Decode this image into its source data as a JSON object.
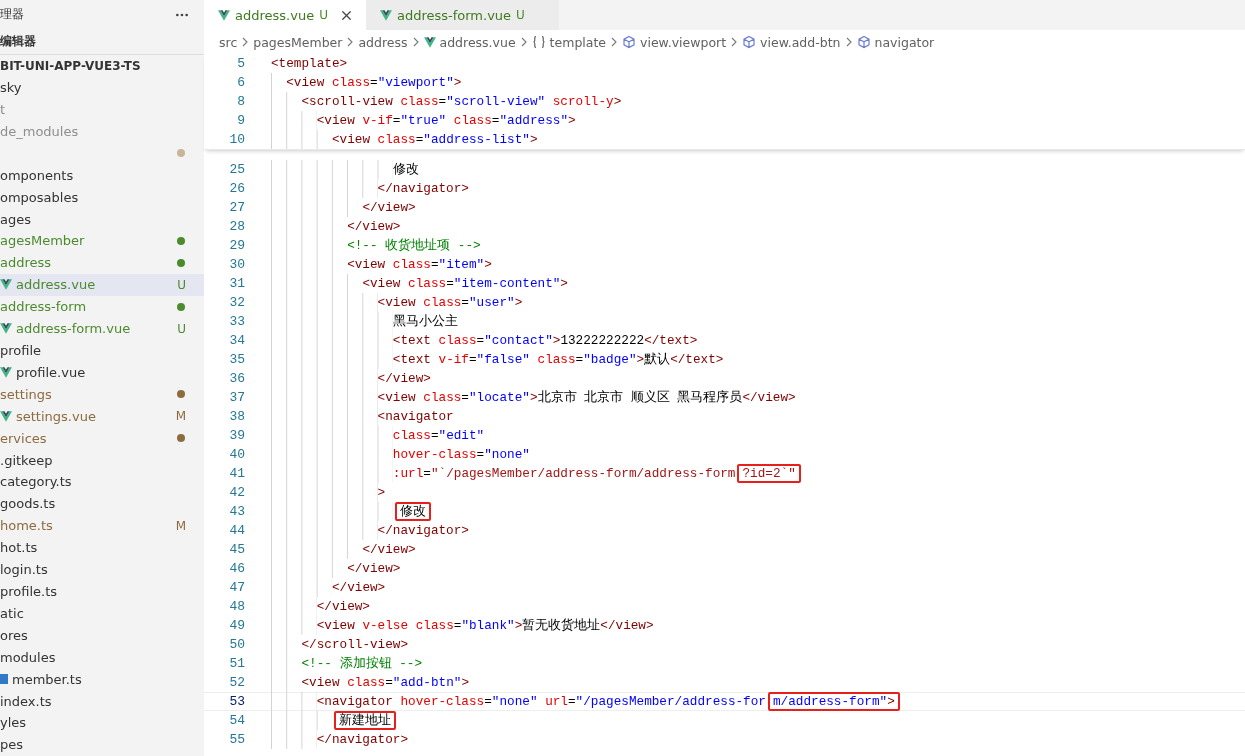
{
  "sidebar": {
    "title": "理器",
    "section": "编辑器",
    "project": "BIT-UNI-APP-VUE3-TS",
    "items": [
      {
        "label": "sky",
        "kind": "plain",
        "color": "#333333",
        "selected": false
      },
      {
        "label": "t",
        "kind": "plain",
        "color": "#8e8e8e",
        "selected": false
      },
      {
        "label": "de_modules",
        "kind": "plain",
        "color": "#8e8e8e",
        "selected": false
      },
      {
        "kind": "plain",
        "color": "#c9b597",
        "dot": true,
        "selected": false
      },
      {
        "label": "omponents",
        "kind": "plain",
        "color": "#333333",
        "selected": false
      },
      {
        "label": "omposables",
        "kind": "plain",
        "color": "#333333",
        "selected": false
      },
      {
        "label": "ages",
        "kind": "plain",
        "color": "#333333",
        "selected": false
      },
      {
        "label": "agesMember",
        "kind": "plain",
        "color": "#4c8a2e",
        "dot": true,
        "selected": false
      },
      {
        "label": "address",
        "kind": "plain",
        "color": "#4c8a2e",
        "dot": true,
        "selected": false
      },
      {
        "label": "address.vue",
        "kind": "vue",
        "color": "#4c8a2e",
        "badge": "U",
        "selected": true
      },
      {
        "label": "address-form",
        "kind": "plain",
        "color": "#4c8a2e",
        "dot": true,
        "selected": false
      },
      {
        "label": "address-form.vue",
        "kind": "vue",
        "color": "#4c8a2e",
        "badge": "U",
        "selected": false
      },
      {
        "label": "profile",
        "kind": "plain",
        "color": "#333333",
        "selected": false
      },
      {
        "label": "profile.vue",
        "kind": "vue",
        "color": "#333333",
        "selected": false
      },
      {
        "label": "settings",
        "kind": "plain",
        "color": "#8c6c3e",
        "dot": true,
        "selected": false
      },
      {
        "label": "settings.vue",
        "kind": "vue",
        "color": "#8c6c3e",
        "badge": "M",
        "selected": false
      },
      {
        "label": "ervices",
        "kind": "plain",
        "color": "#8c6c3e",
        "dot": true,
        "selected": false
      },
      {
        "label": ".gitkeep",
        "kind": "plain",
        "color": "#333333",
        "selected": false
      },
      {
        "label": "category.ts",
        "kind": "plain",
        "color": "#333333",
        "selected": false
      },
      {
        "label": "goods.ts",
        "kind": "plain",
        "color": "#333333",
        "selected": false
      },
      {
        "label": "home.ts",
        "kind": "plain",
        "color": "#8c6c3e",
        "badge": "M",
        "selected": false
      },
      {
        "label": "hot.ts",
        "kind": "plain",
        "color": "#333333",
        "selected": false
      },
      {
        "label": "login.ts",
        "kind": "plain",
        "color": "#333333",
        "selected": false
      },
      {
        "label": "profile.ts",
        "kind": "plain",
        "color": "#333333",
        "selected": false
      },
      {
        "label": "atic",
        "kind": "plain",
        "color": "#333333",
        "selected": false
      },
      {
        "label": "ores",
        "kind": "plain",
        "color": "#333333",
        "selected": false
      },
      {
        "label": "modules",
        "kind": "plain",
        "color": "#333333",
        "selected": false
      },
      {
        "label": "member.ts",
        "kind": "ts",
        "color": "#333333",
        "selected": false
      },
      {
        "label": "index.ts",
        "kind": "plain",
        "color": "#333333",
        "selected": false
      },
      {
        "label": "yles",
        "kind": "plain",
        "color": "#333333",
        "selected": false
      },
      {
        "label": "pes",
        "kind": "plain",
        "color": "#333333",
        "selected": false
      }
    ]
  },
  "tabs": [
    {
      "label": "address.vue",
      "badge": "U",
      "selected": true
    },
    {
      "label": "address-form.vue",
      "badge": "U",
      "selected": false
    }
  ],
  "breadcrumbs": [
    {
      "label": "src",
      "kind": "plain"
    },
    {
      "label": "pagesMember",
      "kind": "plain"
    },
    {
      "label": "address",
      "kind": "plain"
    },
    {
      "label": "address.vue",
      "kind": "vue"
    },
    {
      "label": "template",
      "kind": "braces"
    },
    {
      "label": "view.viewport",
      "kind": "element"
    },
    {
      "label": "view.add-btn",
      "kind": "element"
    },
    {
      "label": "navigator",
      "kind": "element"
    }
  ],
  "sticky_lines": [
    {
      "number": "5",
      "current": false,
      "tokens": [
        {
          "kind": "tag",
          "text": "<template>"
        }
      ]
    },
    {
      "number": "6",
      "current": false,
      "tokens": [
        {
          "kind": "tag",
          "text": "  <view"
        },
        {
          "kind": "attr",
          "text": " class"
        },
        {
          "kind": "eq",
          "text": "="
        },
        {
          "kind": "str",
          "text": "\"viewport\""
        },
        {
          "kind": "tag",
          "text": ">"
        }
      ]
    },
    {
      "number": "8",
      "current": false,
      "tokens": [
        {
          "kind": "tag",
          "text": "    <scroll-view"
        },
        {
          "kind": "attr",
          "text": " class"
        },
        {
          "kind": "eq",
          "text": "="
        },
        {
          "kind": "str",
          "text": "\"scroll-view\""
        },
        {
          "kind": "attr",
          "text": " scroll-y"
        },
        {
          "kind": "tag",
          "text": ">"
        }
      ]
    },
    {
      "number": "9",
      "current": false,
      "tokens": [
        {
          "kind": "tag",
          "text": "      <view"
        },
        {
          "kind": "attr",
          "text": " v-if"
        },
        {
          "kind": "eq",
          "text": "="
        },
        {
          "kind": "str",
          "text": "\"true\""
        },
        {
          "kind": "attr",
          "text": " class"
        },
        {
          "kind": "eq",
          "text": "="
        },
        {
          "kind": "str",
          "text": "\"address\""
        },
        {
          "kind": "tag",
          "text": ">"
        }
      ]
    },
    {
      "number": "10",
      "current": false,
      "tokens": [
        {
          "kind": "tag",
          "text": "        <view"
        },
        {
          "kind": "attr",
          "text": " class"
        },
        {
          "kind": "eq",
          "text": "="
        },
        {
          "kind": "str",
          "text": "\"address-list\""
        },
        {
          "kind": "tag",
          "text": ">"
        }
      ]
    }
  ],
  "lines": [
    {
      "number": "25",
      "current": false,
      "tokens": [
        {
          "kind": "txt",
          "text": "                修改"
        }
      ]
    },
    {
      "number": "26",
      "current": false,
      "tokens": [
        {
          "kind": "tag",
          "text": "              </navigator>"
        }
      ]
    },
    {
      "number": "27",
      "current": false,
      "tokens": [
        {
          "kind": "tag",
          "text": "            </view>"
        }
      ]
    },
    {
      "number": "28",
      "current": false,
      "tokens": [
        {
          "kind": "tag",
          "text": "          </view>"
        }
      ]
    },
    {
      "number": "29",
      "current": false,
      "tokens": [
        {
          "kind": "cmt",
          "text": "          <!-- 收货地址项 -->"
        }
      ]
    },
    {
      "number": "30",
      "current": false,
      "tokens": [
        {
          "kind": "tag",
          "text": "          <view"
        },
        {
          "kind": "attr",
          "text": " class"
        },
        {
          "kind": "eq",
          "text": "="
        },
        {
          "kind": "str",
          "text": "\"item\""
        },
        {
          "kind": "tag",
          "text": ">"
        }
      ]
    },
    {
      "number": "31",
      "current": false,
      "tokens": [
        {
          "kind": "tag",
          "text": "            <view"
        },
        {
          "kind": "attr",
          "text": " class"
        },
        {
          "kind": "eq",
          "text": "="
        },
        {
          "kind": "str",
          "text": "\"item-content\""
        },
        {
          "kind": "tag",
          "text": ">"
        }
      ]
    },
    {
      "number": "32",
      "current": false,
      "tokens": [
        {
          "kind": "tag",
          "text": "              <view"
        },
        {
          "kind": "attr",
          "text": " class"
        },
        {
          "kind": "eq",
          "text": "="
        },
        {
          "kind": "str",
          "text": "\"user\""
        },
        {
          "kind": "tag",
          "text": ">"
        }
      ]
    },
    {
      "number": "33",
      "current": false,
      "tokens": [
        {
          "kind": "txt",
          "text": "                黑马小公主"
        }
      ]
    },
    {
      "number": "34",
      "current": false,
      "tokens": [
        {
          "kind": "tag",
          "text": "                <text"
        },
        {
          "kind": "attr",
          "text": " class"
        },
        {
          "kind": "eq",
          "text": "="
        },
        {
          "kind": "str",
          "text": "\"contact\""
        },
        {
          "kind": "tag",
          "text": ">"
        },
        {
          "kind": "txt",
          "text": "13222222222"
        },
        {
          "kind": "tag",
          "text": "</text>"
        }
      ]
    },
    {
      "number": "35",
      "current": false,
      "tokens": [
        {
          "kind": "tag",
          "text": "                <text"
        },
        {
          "kind": "attr",
          "text": " v-if"
        },
        {
          "kind": "eq",
          "text": "="
        },
        {
          "kind": "str",
          "text": "\"false\""
        },
        {
          "kind": "attr",
          "text": " class"
        },
        {
          "kind": "eq",
          "text": "="
        },
        {
          "kind": "str",
          "text": "\"badge\""
        },
        {
          "kind": "tag",
          "text": ">"
        },
        {
          "kind": "txt",
          "text": "默认"
        },
        {
          "kind": "tag",
          "text": "</text>"
        }
      ]
    },
    {
      "number": "36",
      "current": false,
      "tokens": [
        {
          "kind": "tag",
          "text": "              </view>"
        }
      ]
    },
    {
      "number": "37",
      "current": false,
      "tokens": [
        {
          "kind": "tag",
          "text": "              <view"
        },
        {
          "kind": "attr",
          "text": " class"
        },
        {
          "kind": "eq",
          "text": "="
        },
        {
          "kind": "str",
          "text": "\"locate\""
        },
        {
          "kind": "tag",
          "text": ">"
        },
        {
          "kind": "txt",
          "text": "北京市 北京市 顺义区 黑马程序员"
        },
        {
          "kind": "tag",
          "text": "</view>"
        }
      ]
    },
    {
      "number": "38",
      "current": false,
      "tokens": [
        {
          "kind": "tag",
          "text": "              <navigator"
        }
      ]
    },
    {
      "number": "39",
      "current": false,
      "tokens": [
        {
          "kind": "attr",
          "text": "                class"
        },
        {
          "kind": "eq",
          "text": "="
        },
        {
          "kind": "str",
          "text": "\"edit\""
        }
      ]
    },
    {
      "number": "40",
      "current": false,
      "tokens": [
        {
          "kind": "attr",
          "text": "                hover-class"
        },
        {
          "kind": "eq",
          "text": "="
        },
        {
          "kind": "str",
          "text": "\"none\""
        }
      ]
    },
    {
      "number": "41",
      "current": false,
      "tokens": [
        {
          "kind": "attr",
          "text": "                :url"
        },
        {
          "kind": "eq",
          "text": "="
        },
        {
          "kind": "url",
          "text": "\"`/pagesMember/address-form/address-form"
        },
        {
          "kind": "url",
          "text": "?id=2`\"",
          "boxed": true
        }
      ]
    },
    {
      "number": "42",
      "current": false,
      "tokens": [
        {
          "kind": "tag",
          "text": "              >"
        }
      ]
    },
    {
      "number": "43",
      "current": false,
      "tokens": [
        {
          "kind": "txt",
          "text": "                修改",
          "boxed": true
        }
      ]
    },
    {
      "number": "44",
      "current": false,
      "tokens": [
        {
          "kind": "tag",
          "text": "              </navigator>"
        }
      ]
    },
    {
      "number": "45",
      "current": false,
      "tokens": [
        {
          "kind": "tag",
          "text": "            </view>"
        }
      ]
    },
    {
      "number": "46",
      "current": false,
      "tokens": [
        {
          "kind": "tag",
          "text": "          </view>"
        }
      ]
    },
    {
      "number": "47",
      "current": false,
      "tokens": [
        {
          "kind": "tag",
          "text": "        </view>"
        }
      ]
    },
    {
      "number": "48",
      "current": false,
      "tokens": [
        {
          "kind": "tag",
          "text": "      </view>"
        }
      ]
    },
    {
      "number": "49",
      "current": false,
      "tokens": [
        {
          "kind": "tag",
          "text": "      <view"
        },
        {
          "kind": "attr",
          "text": " v-else"
        },
        {
          "kind": "attr",
          "text": " class"
        },
        {
          "kind": "eq",
          "text": "="
        },
        {
          "kind": "str",
          "text": "\"blank\""
        },
        {
          "kind": "tag",
          "text": ">"
        },
        {
          "kind": "txt",
          "text": "暂无收货地址"
        },
        {
          "kind": "tag",
          "text": "</view>"
        }
      ]
    },
    {
      "number": "50",
      "current": false,
      "tokens": [
        {
          "kind": "tag",
          "text": "    </scroll-view>"
        }
      ]
    },
    {
      "number": "51",
      "current": false,
      "tokens": [
        {
          "kind": "cmt",
          "text": "    <!-- 添加按钮 -->"
        }
      ]
    },
    {
      "number": "52",
      "current": false,
      "tokens": [
        {
          "kind": "tag",
          "text": "    <view"
        },
        {
          "kind": "attr",
          "text": " class"
        },
        {
          "kind": "eq",
          "text": "="
        },
        {
          "kind": "str",
          "text": "\"add-btn\""
        },
        {
          "kind": "tag",
          "text": ">"
        }
      ]
    },
    {
      "number": "53",
      "current": true,
      "tokens": [
        {
          "kind": "tag",
          "text": "      <navigator"
        },
        {
          "kind": "attr",
          "text": " hover-class"
        },
        {
          "kind": "eq",
          "text": "="
        },
        {
          "kind": "str",
          "text": "\"none\""
        },
        {
          "kind": "attr",
          "text": " url"
        },
        {
          "kind": "eq",
          "text": "="
        },
        {
          "kind": "str",
          "text": "\"/pagesMember/address-for"
        },
        {
          "kind": "str",
          "text": "m/address-form\"",
          "boxed": true
        },
        {
          "kind": "tag",
          "text": ">",
          "boxed": true
        }
      ]
    },
    {
      "number": "54",
      "current": false,
      "tokens": [
        {
          "kind": "txt",
          "text": "        新建地址",
          "boxed": true
        }
      ]
    },
    {
      "number": "55",
      "current": false,
      "tokens": [
        {
          "kind": "tag",
          "text": "      </navigator>"
        }
      ]
    }
  ]
}
